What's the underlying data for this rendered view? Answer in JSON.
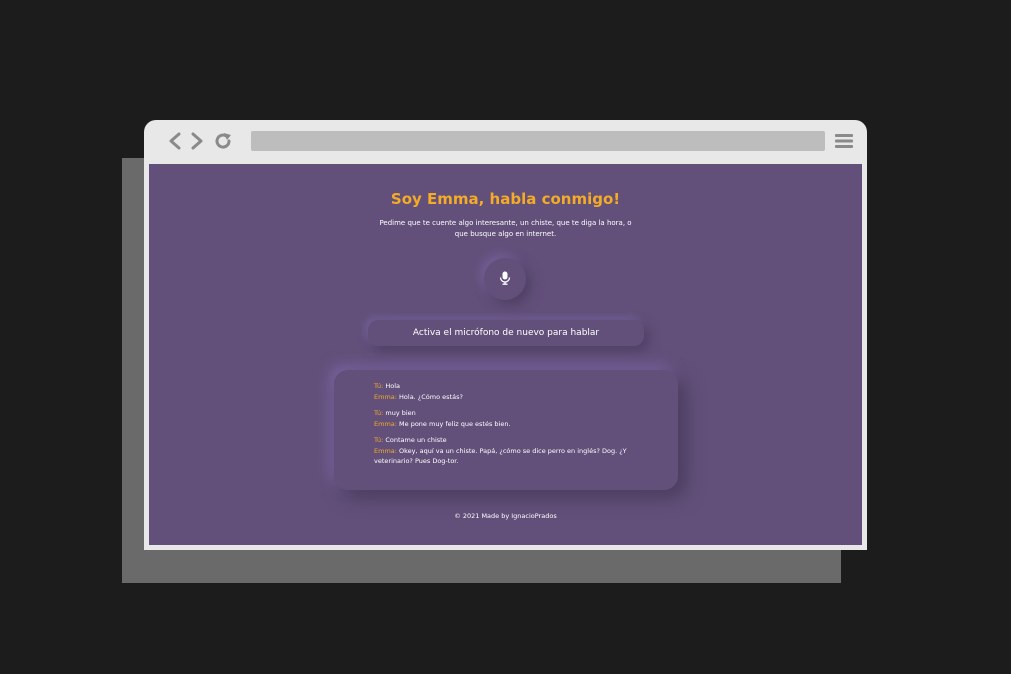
{
  "colors": {
    "background": "#1c1c1c",
    "browser_frame": "#e8e8e8",
    "url_bar": "#bdbdbd",
    "page_background": "#62507a",
    "accent": "#f4ab28",
    "text": "#ffffff"
  },
  "browser": {
    "icons": [
      "back-icon",
      "forward-icon",
      "reload-icon",
      "menu-icon"
    ]
  },
  "page": {
    "title": "Soy Emma, habla conmigo!",
    "subtitle": "Pedime que te cuente algo interesante, un chiste, que te diga la hora, o que busque algo en internet.",
    "mic_icon": "microphone-icon",
    "status": "Activa el micrófono de nuevo para hablar",
    "footer": "© 2021 Made by IgnacioPrados"
  },
  "chat": [
    {
      "user_label": "Tú:",
      "user_text": "Hola",
      "bot_label": "Emma:",
      "bot_text": "Hola. ¿Cómo estás?"
    },
    {
      "user_label": "Tú:",
      "user_text": "muy bien",
      "bot_label": "Emma:",
      "bot_text": "Me pone muy feliz que estés bien."
    },
    {
      "user_label": "Tú:",
      "user_text": "Contame un chiste",
      "bot_label": "Emma:",
      "bot_text": "Okey, aquí va un chiste. Papá, ¿cómo se dice perro en inglés? Dog. ¿Y veterinario? Pues Dog-tor."
    }
  ]
}
